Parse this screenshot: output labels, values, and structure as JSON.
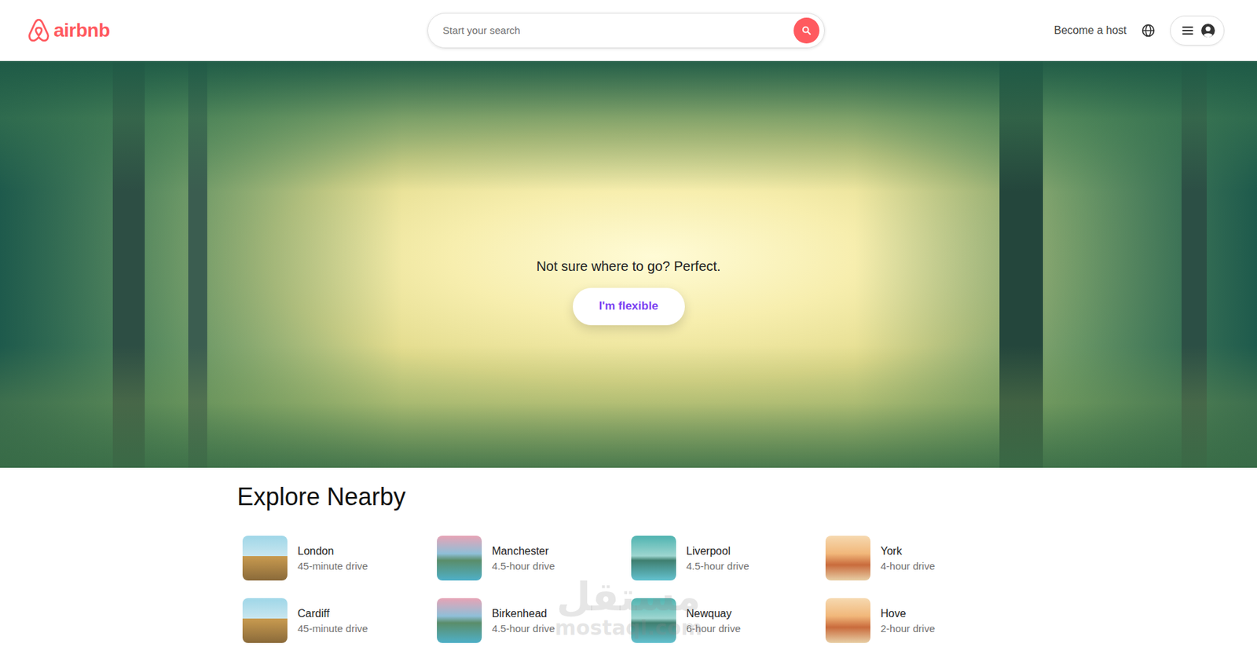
{
  "header": {
    "logo": "airbnb",
    "search": {
      "placeholder": "Start your search"
    },
    "host_link": "Become a host"
  },
  "hero": {
    "prompt": "Not sure where to go? Perfect.",
    "button": "I'm flexible"
  },
  "explore": {
    "title": "Explore Nearby",
    "places": [
      {
        "name": "London",
        "distance": "45-minute drive"
      },
      {
        "name": "Manchester",
        "distance": "4.5-hour drive"
      },
      {
        "name": "Liverpool",
        "distance": "4.5-hour drive"
      },
      {
        "name": "York",
        "distance": "4-hour drive"
      },
      {
        "name": "Cardiff",
        "distance": "45-minute drive"
      },
      {
        "name": "Birkenhead",
        "distance": "4.5-hour drive"
      },
      {
        "name": "Newquay",
        "distance": "6-hour drive"
      },
      {
        "name": "Hove",
        "distance": "2-hour drive"
      }
    ]
  },
  "watermark": {
    "arabic": "مستقل",
    "latin": "mostaql.com"
  }
}
